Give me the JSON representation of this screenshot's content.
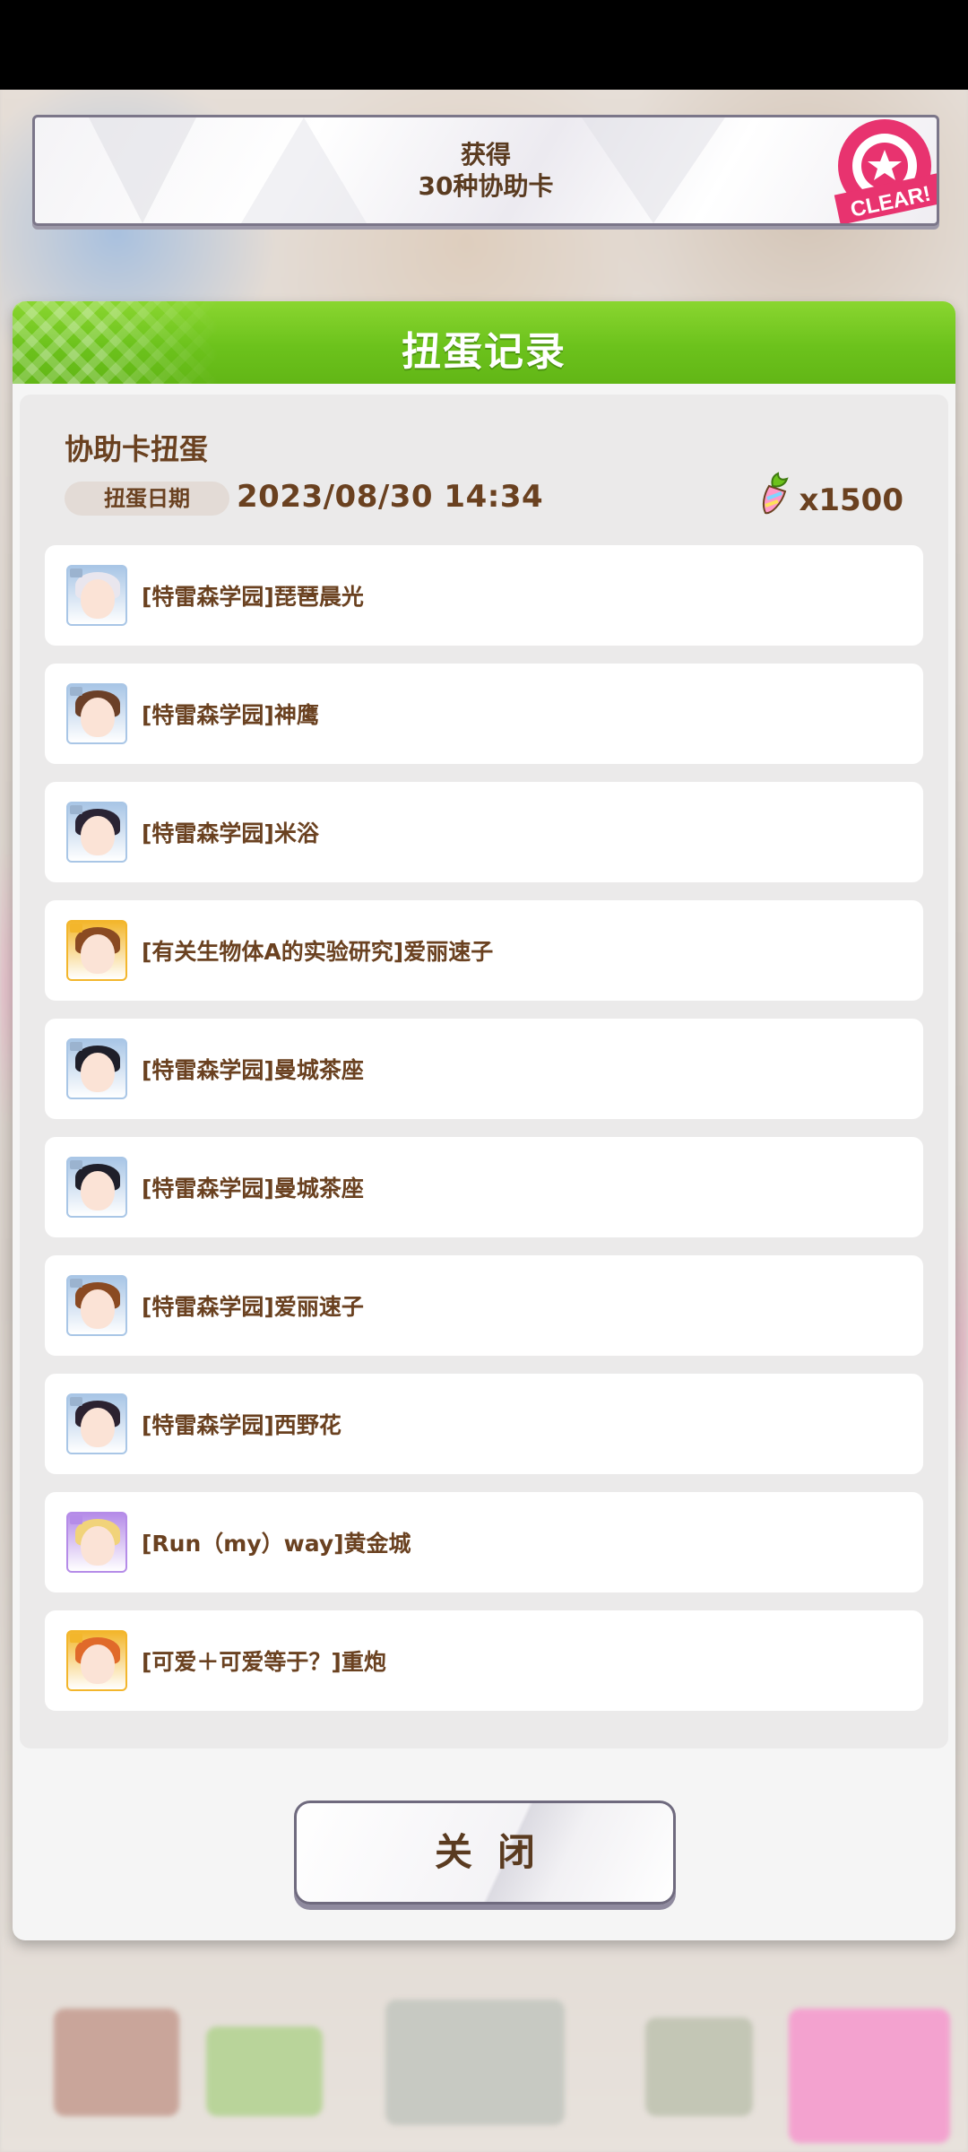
{
  "achievement": {
    "line1": "获得",
    "line2": "30种协助卡",
    "badge_text": "CLEAR!"
  },
  "dialog": {
    "title": "扭蛋记录",
    "section_title": "协助卡扭蛋",
    "date_label": "扭蛋日期",
    "date_value": "2023/08/30  14:34",
    "cost_icon": "carrot-icon",
    "cost": "x1500",
    "close_label": "关闭"
  },
  "results": [
    {
      "label": "[特雷森学园]琵琶晨光",
      "rarity": "r",
      "icon": "character-portrait-icon"
    },
    {
      "label": "[特雷森学园]神鹰",
      "rarity": "r",
      "icon": "character-portrait-icon"
    },
    {
      "label": "[特雷森学园]米浴",
      "rarity": "r",
      "icon": "character-portrait-icon"
    },
    {
      "label": "[有关生物体A的实验研究]爱丽速子",
      "rarity": "ssr",
      "icon": "character-portrait-icon"
    },
    {
      "label": "[特雷森学园]曼城茶座",
      "rarity": "r",
      "icon": "character-portrait-icon"
    },
    {
      "label": "[特雷森学园]曼城茶座",
      "rarity": "r",
      "icon": "character-portrait-icon"
    },
    {
      "label": "[特雷森学园]爱丽速子",
      "rarity": "r",
      "icon": "character-portrait-icon"
    },
    {
      "label": "[特雷森学园]西野花",
      "rarity": "r",
      "icon": "character-portrait-icon"
    },
    {
      "label": "[Run（my）way]黄金城",
      "rarity": "sr",
      "icon": "character-portrait-icon"
    },
    {
      "label": "[可爱＋可爱等于？]重炮",
      "rarity": "ssr",
      "icon": "character-portrait-icon"
    }
  ],
  "colors": {
    "header_green": "#6cc21c",
    "text_brown": "#6a4120",
    "clear_pink": "#e8336f",
    "r_frame": "#a9c6e6",
    "sr_frame": "#b58ce8",
    "ssr_frame": "#f3b62c"
  }
}
